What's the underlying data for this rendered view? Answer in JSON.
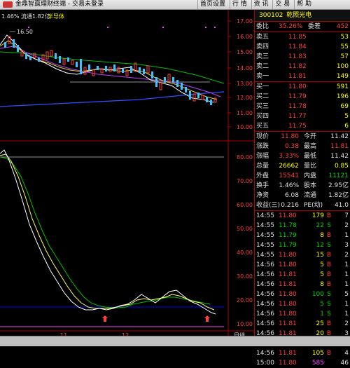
{
  "window": {
    "title": "金鼎智赢理财终端 - 交易未登录"
  },
  "menu": [
    "首页设置",
    "行 情",
    "资 讯",
    "交 易",
    "帮 助"
  ],
  "chart_header": {
    "stats": "1.46% 流通1.82亿",
    "tag": "半导体",
    "max_label": "16.50"
  },
  "price_axis": [
    "17.00",
    "16.00",
    "15.00",
    "14.00",
    "13.00",
    "12.00",
    "11.00",
    "10.00"
  ],
  "ind_axis": [
    "80.00",
    "70.00",
    "60.00",
    "50.00",
    "40.00",
    "30.00",
    "20.00",
    "10.00"
  ],
  "x_labels": [
    "11",
    "12",
    "日线"
  ],
  "quote": {
    "code": "300102",
    "name": "乾照光电",
    "webi_label": "委比",
    "webi": "35.26%",
    "weicha_label": "委差",
    "weicha": "452"
  },
  "asks": [
    {
      "label": "卖五",
      "price": "11.85",
      "vol": "53"
    },
    {
      "label": "卖四",
      "price": "11.84",
      "vol": "55"
    },
    {
      "label": "卖三",
      "price": "11.83",
      "vol": "57"
    },
    {
      "label": "卖二",
      "price": "11.82",
      "vol": "100"
    },
    {
      "label": "卖一",
      "price": "11.81",
      "vol": "149"
    }
  ],
  "bids": [
    {
      "label": "买一",
      "price": "11.80",
      "vol": "591"
    },
    {
      "label": "买二",
      "price": "11.79",
      "vol": "196"
    },
    {
      "label": "买三",
      "price": "11.78",
      "vol": "69"
    },
    {
      "label": "买四",
      "price": "11.77",
      "vol": "5"
    },
    {
      "label": "买五",
      "price": "11.75",
      "vol": "6"
    }
  ],
  "stats": [
    {
      "l1": "现价",
      "v1": "11.80",
      "l2": "今开",
      "v2": "11.42"
    },
    {
      "l1": "涨跌",
      "v1": "0.38",
      "l2": "最高",
      "v2": "11.81"
    },
    {
      "l1": "涨幅",
      "v1": "3.33%",
      "l2": "最低",
      "v2": "11.42"
    },
    {
      "l1": "总量",
      "v1": "26662",
      "l2": "量比",
      "v2": "0.85"
    },
    {
      "l1": "外盘",
      "v1": "15541",
      "l2": "内盘",
      "v2": "11121"
    },
    {
      "l1": "换手",
      "v1": "1.46%",
      "l2": "股本",
      "v2": "2.95亿"
    },
    {
      "l1": "净资",
      "v1": "6.08",
      "l2": "流通",
      "v2": "1.82亿"
    },
    {
      "l1": "收益(三)",
      "v1": "0.216",
      "l2": "PE(动)",
      "v2": "41.0"
    }
  ],
  "ticks": [
    {
      "t": "14:55",
      "p": "11.80",
      "v": "179",
      "s": "B",
      "n": "7"
    },
    {
      "t": "14:55",
      "p": "11.78",
      "v": "22",
      "s": "S",
      "n": "2"
    },
    {
      "t": "14:55",
      "p": "11.79",
      "v": "8",
      "s": "B",
      "n": "1"
    },
    {
      "t": "14:55",
      "p": "11.79",
      "v": "12",
      "s": "S",
      "n": "3"
    },
    {
      "t": "14:55",
      "p": "11.80",
      "v": "15",
      "s": "B",
      "n": "2"
    },
    {
      "t": "14:56",
      "p": "11.80",
      "v": "5",
      "s": "B",
      "n": "1"
    },
    {
      "t": "14:56",
      "p": "11.81",
      "v": "5",
      "s": "B",
      "n": "1"
    },
    {
      "t": "14:56",
      "p": "11.81",
      "v": "8",
      "s": "B",
      "n": "1"
    },
    {
      "t": "14:56",
      "p": "11.80",
      "v": "100",
      "s": "S",
      "n": "5"
    },
    {
      "t": "14:56",
      "p": "11.80",
      "v": "5",
      "s": "S",
      "n": "1"
    },
    {
      "t": "14:56",
      "p": "11.80",
      "v": "1",
      "s": "S",
      "n": "1"
    },
    {
      "t": "14:56",
      "p": "11.81",
      "v": "25",
      "s": "B",
      "n": "2"
    },
    {
      "t": "14:56",
      "p": "11.81",
      "v": "20",
      "s": "B",
      "n": "3"
    },
    {
      "t": "14:56",
      "p": "11.80",
      "v": "8",
      "s": "S",
      "n": "1"
    },
    {
      "t": "14:56",
      "p": "11.81",
      "v": "105",
      "s": "B",
      "n": "4"
    },
    {
      "t": "15:00",
      "p": "11.80",
      "v": "585",
      "s": "",
      "n": "46"
    }
  ]
}
